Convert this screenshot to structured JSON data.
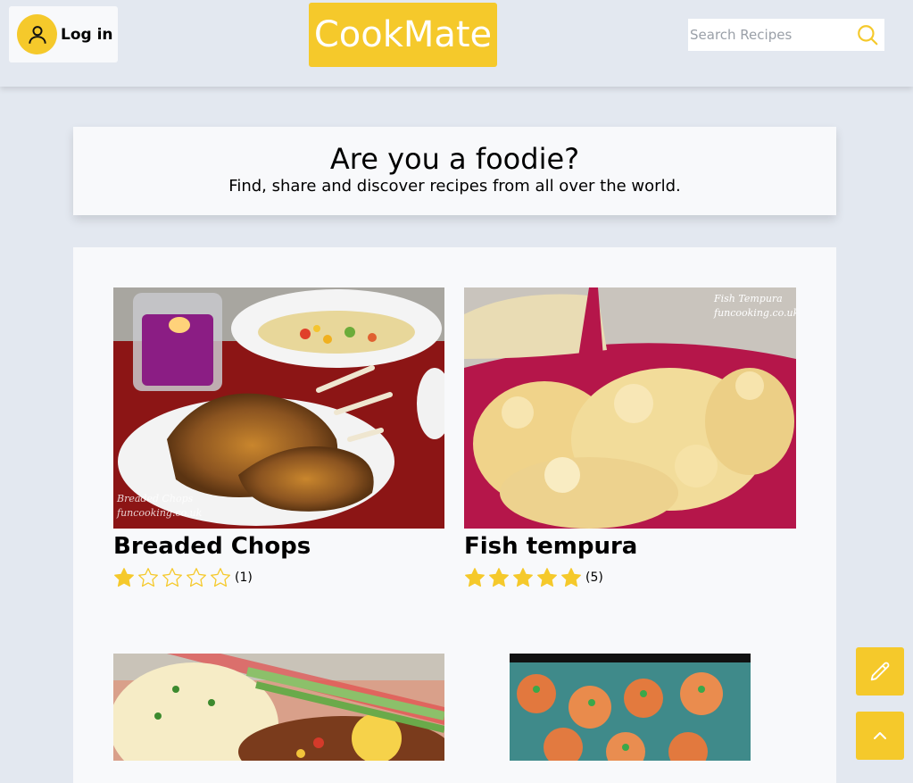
{
  "header": {
    "login_label": "Log in",
    "logo_text": "CookMate",
    "search_placeholder": "Search Recipes"
  },
  "hero": {
    "title": "Are you a foodie?",
    "subtitle": "Find, share and discover recipes from all over the world."
  },
  "recipes": [
    {
      "title": "Breaded Chops",
      "rating": 1,
      "max_rating": 5,
      "rating_count": "(1)",
      "watermark": "Breaded Chops funcooking.co.uk"
    },
    {
      "title": "Fish tempura",
      "rating": 5,
      "max_rating": 5,
      "rating_count": "(5)",
      "watermark": "Fish Tempura funcooking.co.uk"
    }
  ],
  "colors": {
    "accent": "#f5c92b",
    "background": "#e3e8f0",
    "card": "#f8f9fb"
  },
  "icons": {
    "login": "user-icon",
    "search": "search-icon",
    "edit_fab": "pencil-icon",
    "top_fab": "chevron-up-icon"
  }
}
